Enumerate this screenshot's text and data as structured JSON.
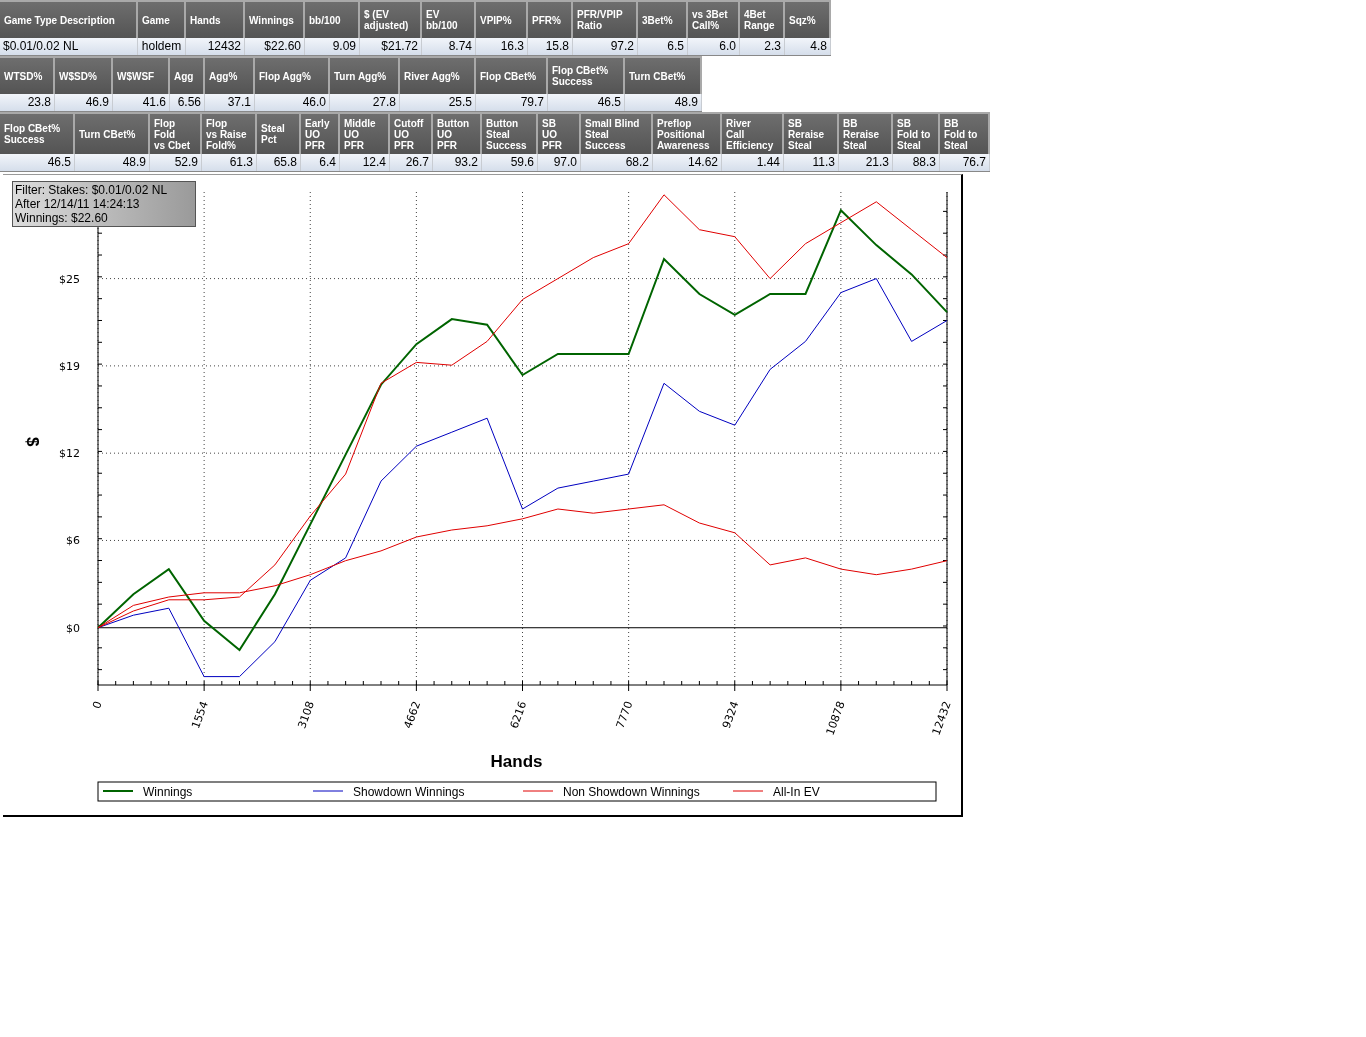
{
  "stats_tables": [
    {
      "columns": [
        "Game Type Description",
        "Game",
        "Hands",
        "Winnings",
        "bb/100",
        "$ (EV\nadjusted)",
        "EV\nbb/100",
        "VPIP%",
        "PFR%",
        "PFR/VPIP\nRatio",
        "3Bet%",
        "vs 3Bet\nCall%",
        "4Bet\nRange",
        "Sqz%"
      ],
      "row": [
        "$0.01/0.02 NL",
        "holdem",
        "12432",
        "$22.60",
        "9.09",
        "$21.72",
        "8.74",
        "16.3",
        "15.8",
        "97.2",
        "6.5",
        "6.0",
        "2.3",
        "4.8"
      ]
    },
    {
      "columns": [
        "WTSD%",
        "W$SD%",
        "W$WSF",
        "Agg",
        "Agg%",
        "Flop Agg%",
        "Turn Agg%",
        "River Agg%",
        "Flop CBet%",
        "Flop CBet%\nSuccess",
        "Turn CBet%"
      ],
      "row": [
        "23.8",
        "46.9",
        "41.6",
        "6.56",
        "37.1",
        "46.0",
        "27.8",
        "25.5",
        "79.7",
        "46.5",
        "48.9"
      ]
    },
    {
      "columns": [
        "Flop CBet%\nSuccess",
        "Turn CBet%",
        "Flop\nFold\nvs Cbet",
        "Flop\nvs Raise\nFold%",
        "Steal\nPct",
        "Early\nUO\nPFR",
        "Middle\nUO\nPFR",
        "Cutoff\nUO\nPFR",
        "Button\nUO\nPFR",
        "Button\nSteal\nSuccess",
        "SB\nUO\nPFR",
        "Small Blind\nSteal\nSuccess",
        "Preflop\nPositional\nAwareness",
        "River\nCall\nEfficiency",
        "SB\nReraise\nSteal",
        "BB\nReraise\nSteal",
        "SB\nFold to\nSteal",
        "BB\nFold to\nSteal"
      ],
      "row": [
        "46.5",
        "48.9",
        "52.9",
        "61.3",
        "65.8",
        "6.4",
        "12.4",
        "26.7",
        "93.2",
        "59.6",
        "97.0",
        "68.2",
        "14.62",
        "1.44",
        "11.3",
        "21.3",
        "88.3",
        "76.7"
      ]
    }
  ],
  "chart": {
    "filter_info": [
      "Filter: Stakes: $0.01/0.02 NL",
      "After 12/14/11 14:24:13",
      "Winnings: $22.60"
    ],
    "chart_data": {
      "type": "line",
      "xlabel": "Hands",
      "ylabel": "$",
      "x": [
        0,
        518,
        1036,
        1554,
        2072,
        2590,
        3108,
        3626,
        4144,
        4662,
        5180,
        5698,
        6216,
        6734,
        7252,
        7770,
        8288,
        8806,
        9324,
        9842,
        10360,
        10878,
        11396,
        11914,
        12432
      ],
      "series": [
        {
          "name": "Winnings",
          "color": "#006400",
          "values": [
            0,
            2.4,
            4.2,
            0.5,
            -1.6,
            2.4,
            7.4,
            12.4,
            17.4,
            20.3,
            22.1,
            21.7,
            18.1,
            19.6,
            19.6,
            19.6,
            26.4,
            23.9,
            22.4,
            23.9,
            23.9,
            29.9,
            27.4,
            25.3,
            22.6
          ]
        },
        {
          "name": "Showdown Winnings",
          "color": "#0000c0",
          "values": [
            0,
            0.9,
            1.4,
            -3.5,
            -3.5,
            -1,
            3.4,
            5.0,
            10.5,
            13.0,
            14.0,
            15.0,
            8.5,
            10.0,
            10.5,
            11.0,
            17.5,
            15.5,
            14.5,
            18.5,
            20.5,
            24.0,
            25.0,
            20.5,
            22.0
          ]
        },
        {
          "name": "Non Showdown Winnings",
          "color": "#e00000",
          "values": [
            0,
            1.2,
            2.0,
            2.0,
            2.2,
            4.5,
            8.0,
            11.0,
            17.5,
            19.0,
            18.8,
            20.5,
            23.5,
            25.0,
            26.5,
            27.5,
            31.0,
            28.5,
            28.0,
            25.0,
            27.5,
            29.0,
            30.5,
            28.5,
            26.5
          ]
        },
        {
          "name": "All-In EV",
          "color": "#e00000",
          "values": [
            0,
            1.6,
            2.2,
            2.5,
            2.5,
            3.0,
            3.8,
            4.8,
            5.5,
            6.5,
            7.0,
            7.3,
            7.8,
            8.5,
            8.2,
            8.5,
            8.8,
            7.5,
            6.8,
            4.5,
            5.0,
            4.2,
            3.8,
            4.2,
            4.8
          ]
        }
      ],
      "grid": true,
      "legend": "bottom",
      "xlim": [
        0,
        12432
      ],
      "ylim": [
        -4.1,
        31.2
      ],
      "xticks": [
        0,
        1554,
        3108,
        4662,
        6216,
        7770,
        9324,
        10878,
        12432
      ],
      "yticks": [
        {
          "value": 0,
          "label": "$0"
        },
        {
          "value": 6.25,
          "label": "$6"
        },
        {
          "value": 12.5,
          "label": "$12"
        },
        {
          "value": 18.75,
          "label": "$19"
        },
        {
          "value": 25,
          "label": "$25"
        }
      ]
    }
  }
}
